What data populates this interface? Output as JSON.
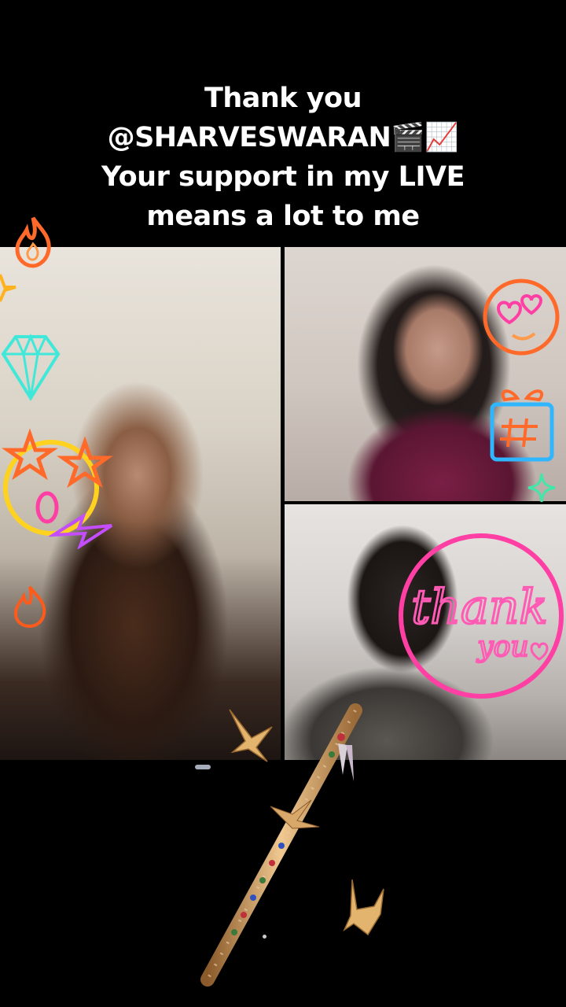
{
  "caption": {
    "line1": "Thank you",
    "line2": "@SHARVESWARAN🎬📈",
    "line3": "Your support in my LIVE",
    "line4": "means a lot to me"
  },
  "stickers": {
    "thank_you_sign_line1": "thank",
    "thank_you_sign_line2": "you"
  },
  "colors": {
    "neon_pink": "#ff3fa4",
    "neon_orange": "#ff6a2a",
    "neon_yellow": "#ffd21f",
    "neon_cyan": "#3fe8d8",
    "neon_purple": "#c34dff",
    "background": "#000000"
  },
  "icons": [
    "fire-icon",
    "diamond-icon",
    "star-eyes-face-icon",
    "lightning-icon",
    "hearts-face-icon",
    "gift-icon",
    "sparkle-icon",
    "flute-gift",
    "paper-crane-icon"
  ]
}
